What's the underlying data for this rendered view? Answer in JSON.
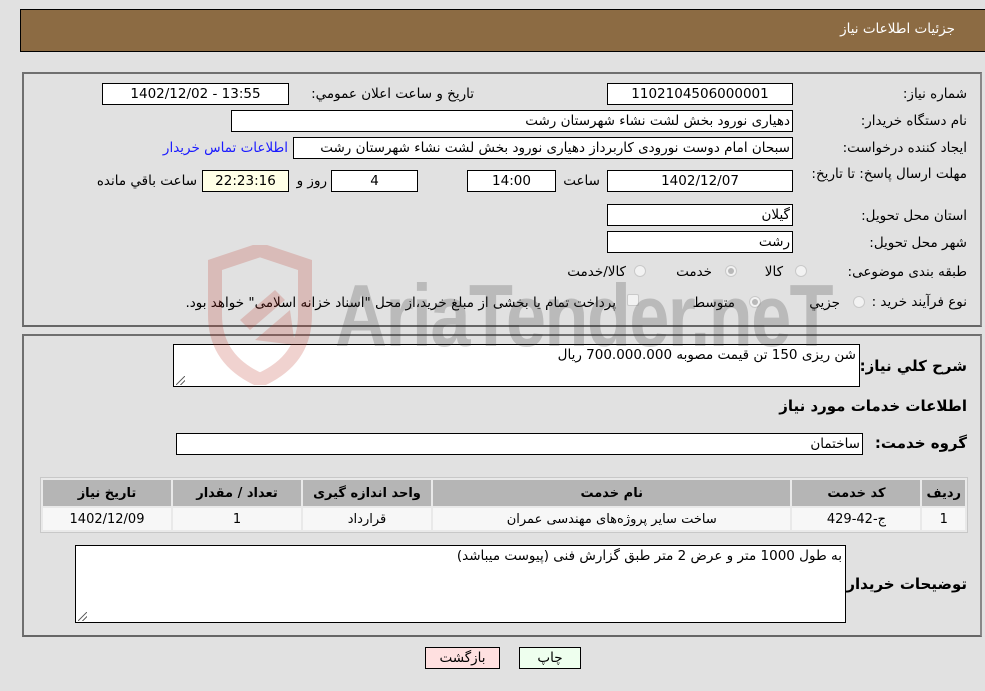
{
  "header": {
    "title": "جزئيات اطلاعات نياز"
  },
  "fields": {
    "need_number_label": "شماره نياز:",
    "need_number": "1102104506000001",
    "announce_label": "تاريخ و ساعت اعلان عمومي:",
    "announce_value": "1402/12/02 - 13:55",
    "buyer_org_label": "نام دستگاه خريدار:",
    "buyer_org": "دهیاری نورود بخش لشت نشاء شهرستان رشت",
    "creator_label": "ايجاد کننده درخواست:",
    "creator": "سبحان امام دوست نورودی کاربرداز دهیاری نورود بخش لشت نشاء شهرستان رشت",
    "contact_link": "اطلاعات تماس خريدار",
    "deadline_label": "مهلت ارسال پاسخ: تا تاريخ:",
    "deadline_date": "1402/12/07",
    "time_label": "ساعت",
    "deadline_time": "14:00",
    "days_value": "4",
    "days_label": "روز و",
    "remaining_time": "22:23:16",
    "remaining_label": "ساعت باقي مانده",
    "province_label": "استان محل تحويل:",
    "province": "گيلان",
    "city_label": "شهر محل تحويل:",
    "city": "رشت",
    "category_label": "طبقه بندی موضوعی:",
    "category_options": [
      {
        "label": "کالا",
        "checked": false
      },
      {
        "label": "خدمت",
        "checked": true
      },
      {
        "label": "کالا/خدمت",
        "checked": false
      }
    ],
    "process_label": "نوع فرآيند خريد :",
    "process_options": [
      {
        "label": "جزيي",
        "checked": false
      },
      {
        "label": "متوسط",
        "checked": true
      }
    ],
    "treasury_note": "پرداخت تمام يا بخشی از مبلغ خريد،از محل \"اسناد خزانه اسلامی\" خواهد بود.",
    "treasury_checked": false
  },
  "details": {
    "summary_label": "شرح کلي نياز:",
    "summary": "شن ریزی 150 تن قیمت مصوبه 700.000.000 ریال",
    "services_heading": "اطلاعات خدمات مورد نياز",
    "service_group_label": "گروه خدمت:",
    "service_group": "ساختمان",
    "table": {
      "headers": [
        "رديف",
        "کد خدمت",
        "نام خدمت",
        "واحد اندازه گيری",
        "تعداد / مقدار",
        "تاريخ نياز"
      ],
      "rows": [
        [
          "1",
          "ج-42-429",
          "ساخت سایر پروژه‌های مهندسی عمران",
          "قرارداد",
          "1",
          "1402/12/09"
        ]
      ]
    },
    "buyer_notes_label": "توضيحات خريدار:",
    "buyer_notes": "به طول 1000 متر و عرض 2 متر طبق گزارش فنی (پیوست میباشد)"
  },
  "buttons": {
    "print": "چاپ",
    "back": "بازگشت"
  },
  "watermark": {
    "text": "AriaTender.neT"
  },
  "colors": {
    "header_bg": "#8c6b43",
    "print_bg": "#eeffee",
    "back_bg": "#ffe0e0",
    "link": "#1a1aff"
  }
}
